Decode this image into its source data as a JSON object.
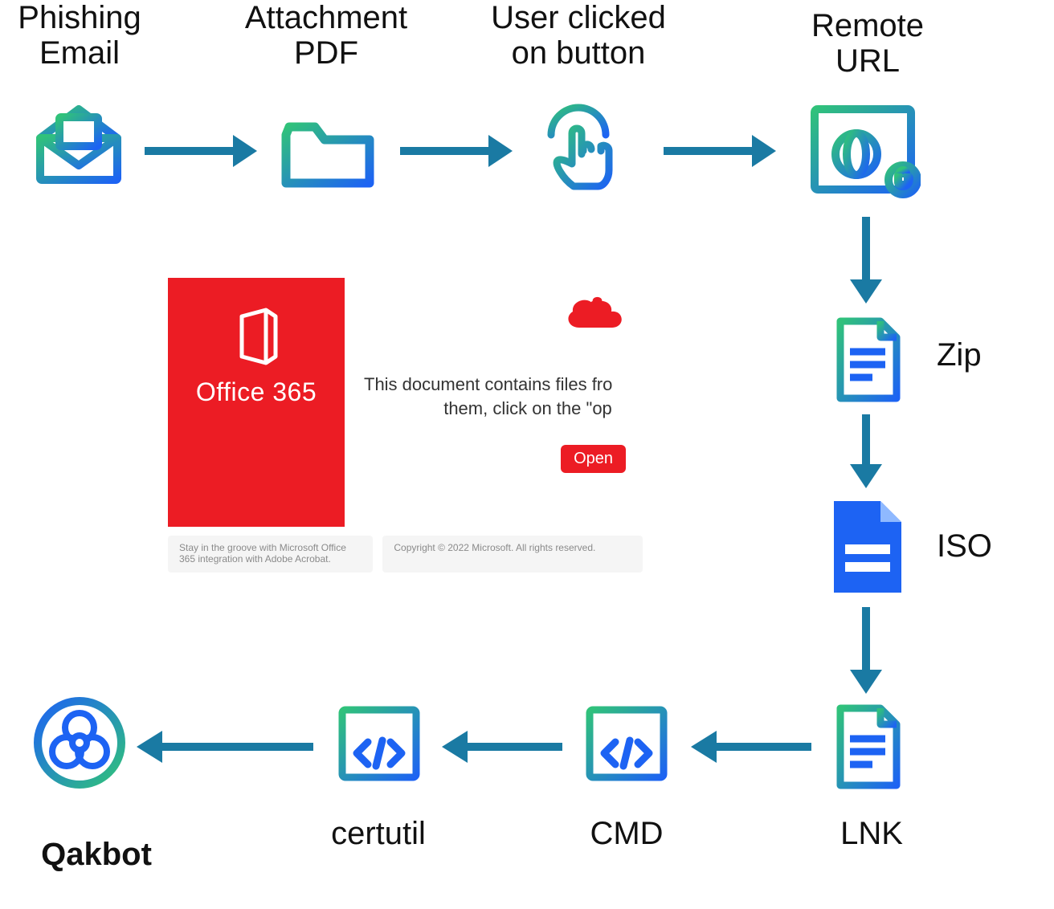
{
  "nodes": {
    "phishing_email": "Phishing\nEmail",
    "attachment_pdf": "Attachment\nPDF",
    "user_clicked": "User clicked\non button",
    "remote_url": "Remote\nURL",
    "zip": "Zip",
    "iso": "ISO",
    "lnk": "LNK",
    "cmd": "CMD",
    "certutil": "certutil",
    "qakbot": "Qakbot"
  },
  "lure": {
    "product": "Office 365",
    "body_line1": "This document contains files fro",
    "body_line2": "them, click on the \"op",
    "open": "Open",
    "footer_left": "Stay in the groove with Microsoft Office 365 integration with Adobe Acrobat.",
    "footer_right": "Copyright © 2022 Microsoft. All rights reserved."
  },
  "colors": {
    "arrow": "#1a7aa3",
    "grad_green": "#2ecc71",
    "grad_blue": "#1d63f3",
    "ms_red": "#ec1c24"
  }
}
